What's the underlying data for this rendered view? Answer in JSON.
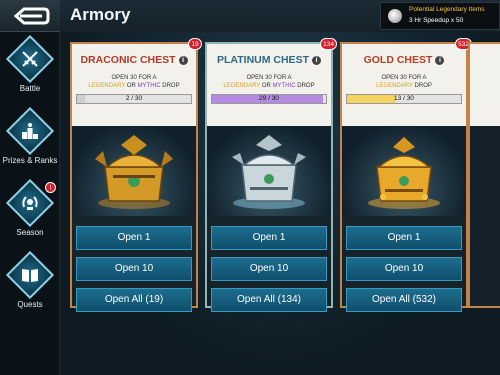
{
  "header": {
    "title": "Armory",
    "legendary_title": "Potential Legendary Items",
    "legendary_sub": "3 Hr Speedup x 50"
  },
  "sidebar": {
    "items": [
      {
        "label": "Battle",
        "icon": "crossed-swords-icon"
      },
      {
        "label": "Prizes & Ranks",
        "icon": "podium-icon"
      },
      {
        "label": "Season",
        "icon": "laurel-icon",
        "badge": "!"
      },
      {
        "label": "Quests",
        "icon": "book-icon"
      }
    ]
  },
  "chests": [
    {
      "name": "DRACONIC CHEST",
      "badge": "19",
      "desc_1": "OPEN 30 FOR A",
      "desc_legendary": "LEGENDARY",
      "desc_or": " OR ",
      "desc_mythic": "MYTHIC",
      "desc_end": " DROP",
      "progress": "2 / 30",
      "progress_value": 0.07,
      "progress_color": "#cfcfcf",
      "buttons": [
        "Open 1",
        "Open 10",
        "Open All (19)"
      ]
    },
    {
      "name": "PLATINUM CHEST",
      "badge": "134",
      "desc_1": "OPEN 30 FOR A",
      "desc_legendary": "LEGENDARY",
      "desc_or": " OR ",
      "desc_mythic": "MYTHIC",
      "desc_end": " DROP",
      "progress": "29 / 30",
      "progress_value": 0.97,
      "progress_color": "#b48be0",
      "buttons": [
        "Open 1",
        "Open 10",
        "Open All (134)"
      ]
    },
    {
      "name": "GOLD CHEST",
      "badge": "532",
      "desc_1": "OPEN 30 FOR A",
      "desc_legendary": "LEGENDARY",
      "desc_or": "",
      "desc_mythic": "",
      "desc_end": " DROP",
      "progress": "13 / 30",
      "progress_value": 0.43,
      "progress_color": "#f4d35e",
      "buttons": [
        "Open 1",
        "Open 10",
        "Open All (532)"
      ]
    }
  ],
  "colors": {
    "button": "#1d6d8e",
    "badge": "#d71f2a",
    "gold": "#f4c542"
  }
}
